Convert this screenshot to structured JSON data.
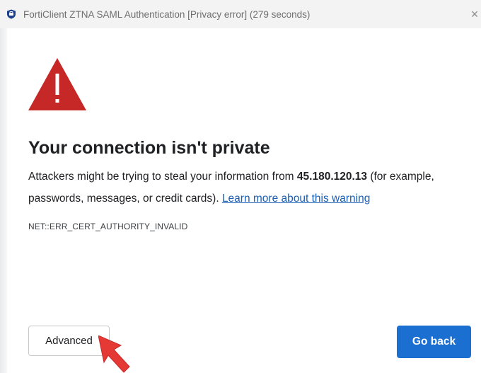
{
  "window": {
    "title": "FortiClient ZTNA SAML Authentication [Privacy error] (279 seconds)",
    "close_glyph": "×"
  },
  "icons": {
    "app": "forticlient-shield-icon",
    "warning": "warning-triangle-icon",
    "cursor": "red-pointer-arrow-icon"
  },
  "page": {
    "heading": "Your connection isn't private",
    "paragraph_part1": "Attackers might be trying to steal your information from ",
    "host": "45.180.120.13",
    "paragraph_part2": " (for example, passwords, messages, or credit cards). ",
    "learn_more": "Learn more about this warning",
    "error_code": "NET::ERR_CERT_AUTHORITY_INVALID"
  },
  "buttons": {
    "advanced": "Advanced",
    "go_back": "Go back"
  },
  "colors": {
    "warning_red": "#c62828",
    "primary_button": "#1a6fd0",
    "link": "#1a5fb4"
  }
}
